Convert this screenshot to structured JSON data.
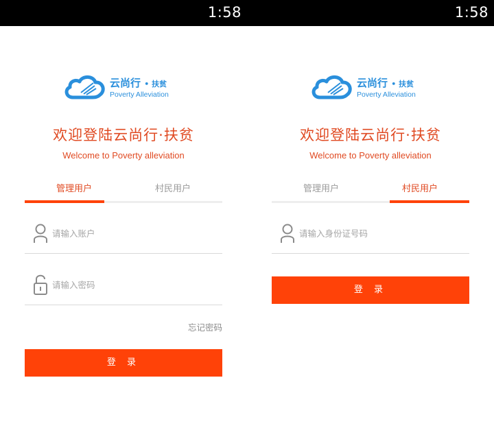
{
  "status_bar": {
    "time": "1:58"
  },
  "logo": {
    "brand": "云尚行",
    "brand_tag": "• 扶贫",
    "subtitle": "Poverty Alleviation"
  },
  "header": {
    "title": "欢迎登陆云尚行·扶贫",
    "subtitle": "Welcome to Poverty alleviation"
  },
  "tabs": [
    {
      "label": "管理用户"
    },
    {
      "label": "村民用户"
    }
  ],
  "admin_form": {
    "account_placeholder": "请输入账户",
    "password_placeholder": "请输入密码",
    "forgot_password": "忘记密码",
    "login_button": "登 录"
  },
  "villager_form": {
    "id_placeholder": "请输入身份证号码",
    "login_button": "登 录"
  },
  "colors": {
    "accent": "#ff4208",
    "title": "#e04a22",
    "logo_blue": "#2a8fdc"
  },
  "icons": {
    "user": "user-icon",
    "lock": "lock-icon",
    "logo": "cloud-logo-icon"
  }
}
